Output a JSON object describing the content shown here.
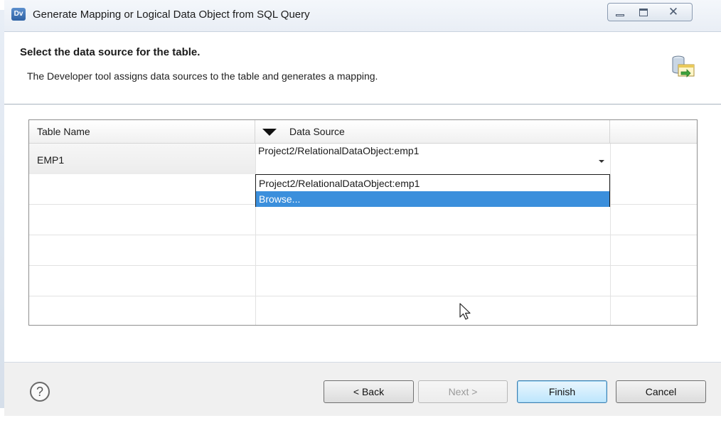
{
  "window": {
    "icon_text": "Dv",
    "title": "Generate Mapping or Logical Data Object from SQL Query",
    "close_glyph": "✕"
  },
  "header": {
    "title": "Select the data source for the table.",
    "description": "The Developer tool assigns data sources to the table and generates a mapping.",
    "icon": "wizard-database-icon"
  },
  "table": {
    "columns": [
      "Table Name",
      "Data Source",
      ""
    ],
    "rows": [
      {
        "table_name": "EMP1",
        "data_source": "Project2/RelationalDataObject:emp1"
      }
    ],
    "dropdown": {
      "options": [
        "Project2/RelationalDataObject:emp1",
        "Browse..."
      ],
      "highlighted": "Browse...",
      "highlight_color": "#3b8fdc"
    }
  },
  "footer": {
    "help_glyph": "?",
    "back_label": "< Back",
    "next_label": "Next >",
    "finish_label": "Finish",
    "cancel_label": "Cancel"
  }
}
